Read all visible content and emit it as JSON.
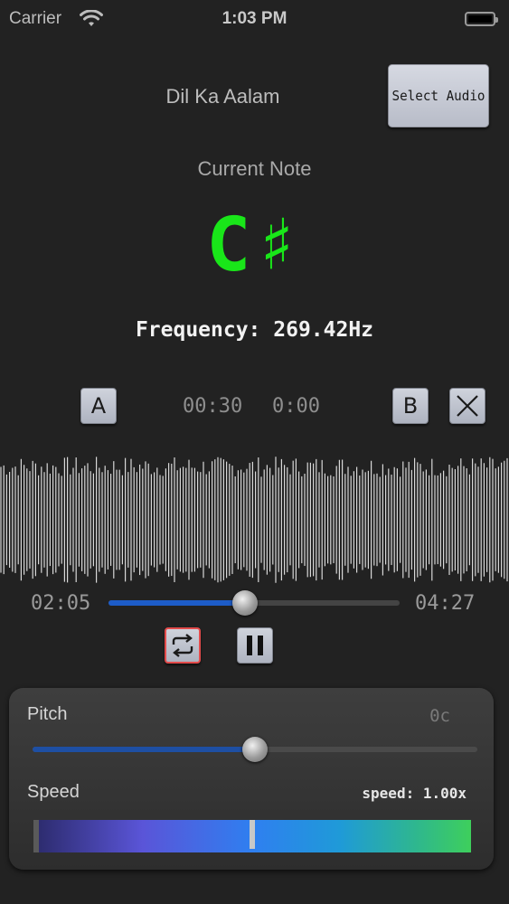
{
  "status_bar": {
    "carrier": "Carrier",
    "time": "1:03 PM",
    "wifi_icon": "wifi-icon",
    "battery_icon": "battery-icon"
  },
  "header": {
    "song_title": "Dil Ka Aalam",
    "select_audio_label": "Select Audio"
  },
  "tuner": {
    "current_note_label": "Current Note",
    "note": "C♯",
    "frequency": "Frequency: 269.42Hz",
    "note_color": "#19e619"
  },
  "loop": {
    "a_label": "A",
    "b_label": "B",
    "clear_label": "✕",
    "start_time": "00:30",
    "end_time": "0:00"
  },
  "playback": {
    "elapsed": "02:05",
    "total": "04:27",
    "progress_fraction": 0.468,
    "repeat_icon": "repeat-icon",
    "pause_icon": "pause-icon",
    "accent": "#1d5cc8",
    "repeat_active_color": "#e34b4b"
  },
  "controls": {
    "pitch_label": "Pitch",
    "pitch_value": "0c",
    "pitch_fraction": 0.5,
    "speed_label": "Speed",
    "speed_value": "speed: 1.00x",
    "speed_fraction": 0.5
  }
}
